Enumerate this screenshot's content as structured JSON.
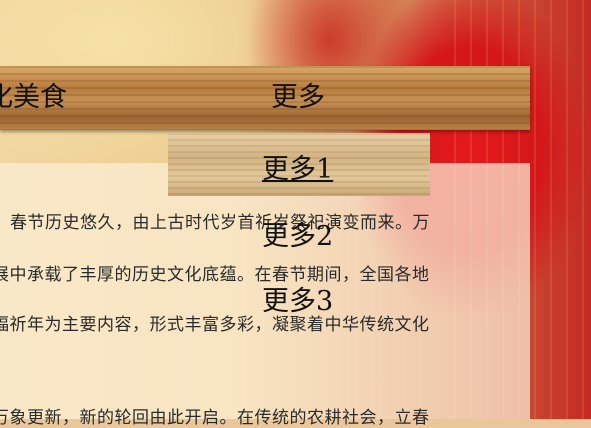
{
  "nav": {
    "food_label": "化美食",
    "more_label": "更多"
  },
  "dropdown": {
    "items": [
      "更多1",
      "更多2",
      "更多3"
    ]
  },
  "content": {
    "lines": [
      "春节历史悠久，由上古时代岁首祈岁祭祀演变而来。万",
      "展中承载了丰厚的历史文化底蕴。在春节期间，全国各地",
      "福祈年为主要内容，形式丰富多彩，凝聚着中华传统文化",
      "万象更新，新的轮回由此开启。在传统的农耕社会，立春"
    ]
  }
}
